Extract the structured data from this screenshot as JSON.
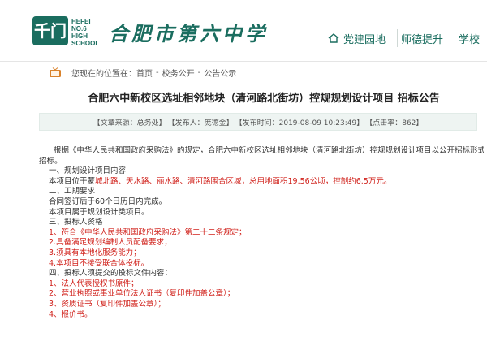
{
  "header": {
    "logo_mark": "千门",
    "logo_en": [
      "HEFEI NO.6",
      "HIGH",
      "SCHOOL"
    ],
    "logo_cn": "合肥市第六中学",
    "nav": [
      {
        "label": "党建园地",
        "icon": "home-icon"
      },
      {
        "label": "师德提升"
      },
      {
        "label": "学校"
      }
    ],
    "brand_color": "#1a6d5f"
  },
  "breadcrumb": {
    "label": "您现在的位置在：",
    "items": [
      "首页",
      "校务公开",
      "公告公示"
    ],
    "separator": "-"
  },
  "article": {
    "title": "合肥六中新校区选址相邻地块（清河路北街坊）控规规划设计项目 招标公告",
    "meta": {
      "source": "【文章来源：总务处】",
      "author": "【发布人：庞德金】",
      "time": "【发布时间：2019-08-09 10:23:49】",
      "hits": "【点击率：862】"
    },
    "lines": [
      {
        "text": "根据《中华人民共和国政府采购法》的规定，合肥六中新校区选址相邻地块（清河路北街坊）控规规划设计项目以公开招标形式进行",
        "cls": "indent2"
      },
      {
        "text": "招标。",
        "cls": ""
      },
      {
        "text": "一、规划设计项目内容",
        "cls": "indent1"
      },
      {
        "text": "本项目位于蒙城北路、天水路、丽水路、清河路围合区域，总用地面积19.56公顷，控制约6.5万元。",
        "cls": "indent1",
        "red_from": 6
      },
      {
        "text": "二、工期要求",
        "cls": "indent1"
      },
      {
        "text": "合同签订后于60个日历日内完成。",
        "cls": "indent1"
      },
      {
        "text": "本项目属于规划设计类项目。",
        "cls": "indent1"
      },
      {
        "text": "三、投标人资格",
        "cls": "indent1"
      },
      {
        "text": "1、符合《中华人民共和国政府采购法》第二十二条规定；",
        "cls": "indent1",
        "red": true
      },
      {
        "text": "2.具备满足规划编制人员配备要求；",
        "cls": "indent1",
        "red": true
      },
      {
        "text": "3.须具有本地化服务能力；",
        "cls": "indent1",
        "red": true
      },
      {
        "text": "4.本项目不接受联合体投标。",
        "cls": "indent1",
        "red": true
      },
      {
        "text": "四、投标人须提交的投标文件内容：",
        "cls": "indent1"
      },
      {
        "text": "1、法人代表授权书原件；",
        "cls": "indent1",
        "red": true
      },
      {
        "text": "2、营业执照或事业单位法人证书（复印件加盖公章）；",
        "cls": "indent1",
        "red": true
      },
      {
        "text": "3、资质证书（复印件加盖公章）；",
        "cls": "indent1",
        "red": true
      },
      {
        "text": "4、报价书。",
        "cls": "indent1",
        "red": true
      }
    ]
  }
}
